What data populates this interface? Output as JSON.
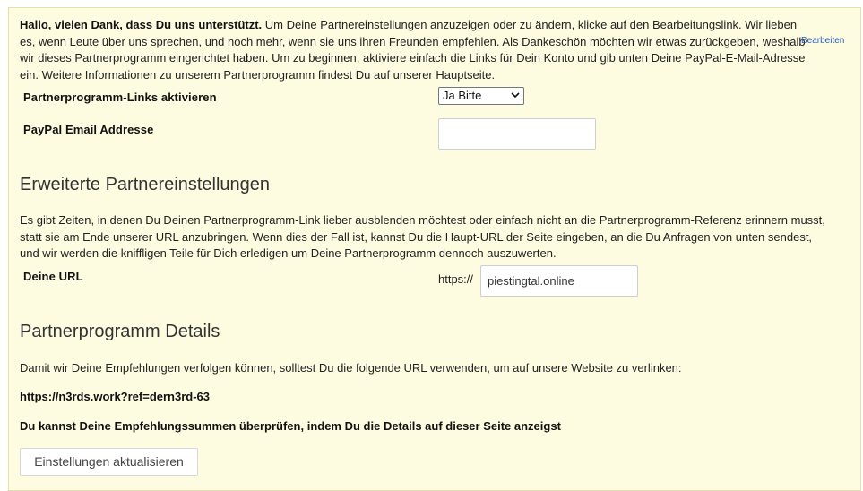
{
  "intro": {
    "bold": "Hallo, vielen Dank, dass Du uns unterstützt.",
    "text": " Um Deine Partnereinstellungen anzuzeigen oder zu ändern, klicke auf den Bearbeitungslink. Wir lieben es, wenn Leute über uns sprechen, und noch mehr, wenn sie uns ihren Freunden empfehlen. Als Dankeschön möchten wir etwas zurückgeben, weshalb wir dieses Partnerprogramm eingerichtet haben. Um zu beginnen, aktiviere einfach die Links für Dein Konto und gib unten Deine PayPal-E-Mail-Adresse ein. Weitere Informationen zu unserem Partnerprogramm findest Du auf unserer Hauptseite.",
    "edit_link": "Bearbeiten"
  },
  "affiliate": {
    "enable_label": "Partnerprogramm-Links aktivieren",
    "enable_value": "Ja Bitte",
    "paypal_label": "PayPal Email Addresse",
    "paypal_value": ""
  },
  "advanced": {
    "heading": "Erweiterte Partnereinstellungen",
    "text": "Es gibt Zeiten, in denen Du Deinen Partnerprogramm-Link lieber ausblenden möchtest oder einfach nicht an die Partnerprogramm-Referenz erinnern musst, statt sie am Ende unserer URL anzubringen. Wenn dies der Fall ist, kannst Du die Haupt-URL der Seite eingeben, an die Du Anfragen von unten sendest, und wir werden die kniffligen Teile für Dich erledigen um Deine Partnerprogramm dennoch auszuwerten.",
    "url_label": "Deine URL",
    "url_prefix": "https://",
    "url_value": "piestingtal.online"
  },
  "details": {
    "heading": "Partnerprogramm Details",
    "text": "Damit wir Deine Empfehlungen verfolgen können, solltest Du die folgende URL verwenden, um auf unsere Website zu verlinken:",
    "ref_url": "https://n3rds.work?ref=dern3rd-63",
    "check_text": "Du kannst Deine Empfehlungssummen überprüfen, indem Du die Details auf dieser Seite anzeigst"
  },
  "buttons": {
    "update": "Einstellungen aktualisieren"
  }
}
